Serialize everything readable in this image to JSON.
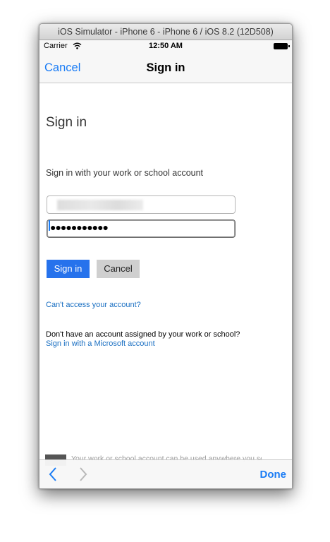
{
  "window": {
    "title": "iOS Simulator - iPhone 6 - iPhone 6 / iOS 8.2 (12D508)"
  },
  "status_bar": {
    "carrier": "Carrier",
    "time": "12:50 AM"
  },
  "nav_bar": {
    "cancel_label": "Cancel",
    "title": "Sign in"
  },
  "form": {
    "heading": "Sign in",
    "subtitle": "Sign in with your work or school account",
    "password_value": "●●●●●●●●●●●",
    "signin_label": "Sign in",
    "cancel_label": "Cancel",
    "cant_access_link": "Can't access your account?",
    "no_account_text": "Don't have an account assigned by your work or school?",
    "microsoft_link": "Sign in with a Microsoft account",
    "footer_text": "Your work or school account can be used anywhere you see this"
  },
  "toolbar": {
    "done_label": "Done"
  },
  "colors": {
    "accent": "#1a7cf5",
    "signin_button": "#2672ec",
    "link": "#1a6fc2"
  }
}
